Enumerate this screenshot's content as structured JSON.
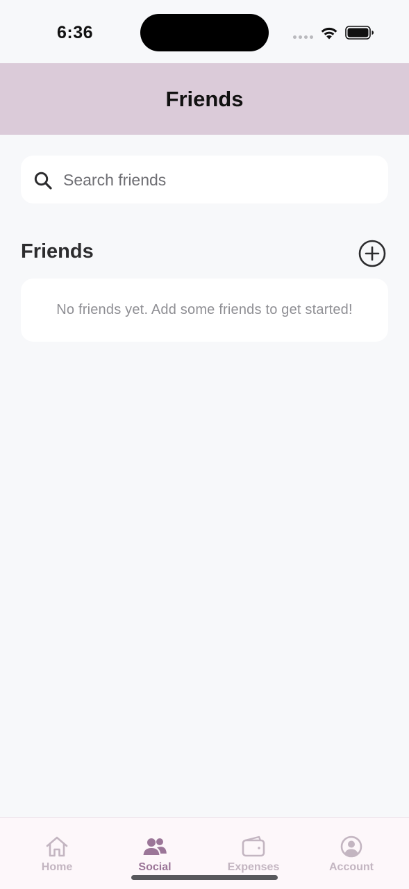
{
  "status_bar": {
    "time": "6:36",
    "icons": [
      "signal-icon",
      "wifi-icon",
      "battery-icon"
    ]
  },
  "header": {
    "title": "Friends"
  },
  "search": {
    "placeholder": "Search friends",
    "value": "",
    "icon": "search-icon"
  },
  "friends_section": {
    "title": "Friends",
    "add_icon": "plus-circle-icon",
    "empty_message": "No friends yet. Add some friends to get started!"
  },
  "tab_bar": {
    "active_tab": "Social",
    "tabs": [
      {
        "label": "Home",
        "icon": "home-icon"
      },
      {
        "label": "Social",
        "icon": "people-icon"
      },
      {
        "label": "Expenses",
        "icon": "wallet-icon"
      },
      {
        "label": "Account",
        "icon": "account-icon"
      }
    ]
  },
  "colors": {
    "header_bg": "#dbcbd9",
    "background": "#f7f8fa",
    "accent": "#9b7698",
    "inactive_tab": "#c3b5c1",
    "tab_bar_bg": "#fdf7fa"
  }
}
